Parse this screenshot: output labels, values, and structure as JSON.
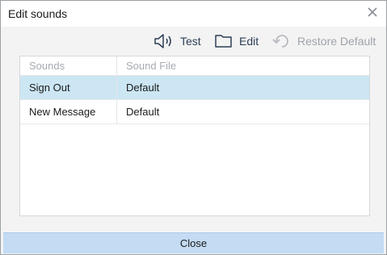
{
  "window": {
    "title": "Edit sounds"
  },
  "toolbar": {
    "test_label": "Test",
    "edit_label": "Edit",
    "restore_label": "Restore Default",
    "icons": {
      "test": "speaker-icon",
      "edit": "folder-icon",
      "restore": "undo-icon"
    }
  },
  "table": {
    "headers": [
      "Sounds",
      "Sound File"
    ],
    "rows": [
      {
        "sound": "Sign Out",
        "file": "Default",
        "selected": true
      },
      {
        "sound": "New Message",
        "file": "Default",
        "selected": false
      }
    ]
  },
  "footer": {
    "close_label": "Close"
  },
  "colors": {
    "selection": "#cce6f4",
    "footer": "#c3dcf3",
    "icon": "#2c3e55",
    "disabled": "#9ea3aa"
  }
}
